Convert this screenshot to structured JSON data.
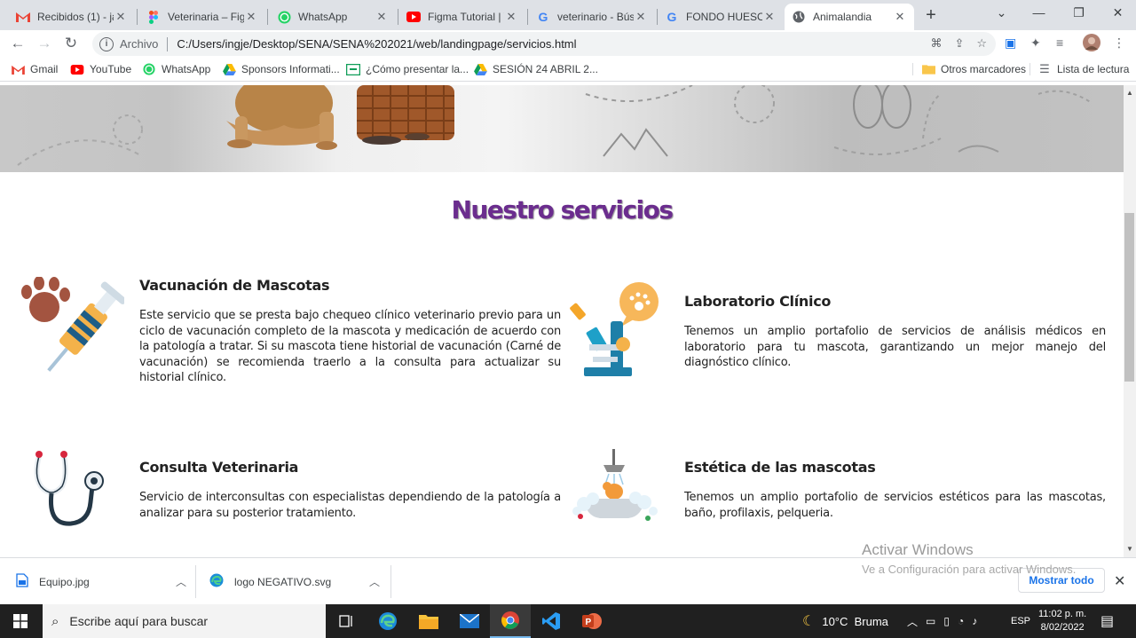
{
  "browser": {
    "tabs": [
      {
        "label": "Recibidos (1) - ja",
        "icon": "gmail-icon",
        "active": false
      },
      {
        "label": "Veterinaria – Figm",
        "icon": "figma-icon",
        "active": false
      },
      {
        "label": "WhatsApp",
        "icon": "whatsapp-icon",
        "active": false
      },
      {
        "label": "Figma Tutorial | V",
        "icon": "youtube-icon",
        "active": false
      },
      {
        "label": "veterinario - Búsq",
        "icon": "google-icon",
        "active": false
      },
      {
        "label": "FONDO HUESOS",
        "icon": "google-icon",
        "active": false
      },
      {
        "label": "Animalandia",
        "icon": "globe-icon",
        "active": true
      }
    ],
    "address": {
      "scheme": "Archivo",
      "url": "C:/Users/ingje/Desktop/SENA/SENA%202021/web/landingpage/servicios.html"
    },
    "bookmarks": [
      {
        "label": "Gmail",
        "icon": "gmail-icon"
      },
      {
        "label": "YouTube",
        "icon": "youtube-icon"
      },
      {
        "label": "WhatsApp",
        "icon": "whatsapp-icon"
      },
      {
        "label": "Sponsors Informati...",
        "icon": "drive-icon"
      },
      {
        "label": "¿Cómo presentar la...",
        "icon": "classroom-icon"
      },
      {
        "label": "SESIÓN 24 ABRIL 2...",
        "icon": "drive-icon"
      }
    ],
    "other_bookmarks": "Otros marcadores",
    "reading_list": "Lista de lectura"
  },
  "page": {
    "section_title": "Nuestro servicios",
    "services": [
      {
        "title": "Vacunación de Mascotas",
        "description": "Este servicio que se presta bajo chequeo clínico veterinario previo para un ciclo de vacunación completo de la mascota y medicación de acuerdo con la patología a tratar. Si su mascota tiene historial de vacunación (Carné de vacunación) se recomienda traerlo a la consulta para actualizar su historial clínico.",
        "icon": "vaccine-syringe-icon"
      },
      {
        "title": "Laboratorio Clínico",
        "description": "Tenemos un amplio portafolio de servicios de análisis médicos en laboratorio para tu mascota, garantizando un mejor manejo del diagnóstico clínico.",
        "icon": "microscope-icon"
      },
      {
        "title": "Consulta Veterinaria",
        "description": "Servicio de interconsultas con especialistas dependiendo de la patología a analizar para su posterior tratamiento.",
        "icon": "stethoscope-icon"
      },
      {
        "title": "Estética de las mascotas",
        "description": "Tenemos un amplio portafolio de servicios estéticos para las mascotas, baño, profilaxis, pelqueria.",
        "icon": "dog-bath-icon"
      }
    ]
  },
  "windows_activation": {
    "title": "Activar Windows",
    "subtitle": "Ve a Configuración para activar Windows."
  },
  "downloads": {
    "items": [
      {
        "name": "Equipo.jpg",
        "icon": "image-file-icon"
      },
      {
        "name": "logo NEGATIVO.svg",
        "icon": "edge-file-icon"
      }
    ],
    "show_all": "Mostrar todo"
  },
  "taskbar": {
    "search_placeholder": "Escribe aquí para buscar",
    "weather": "10°C  Bruma",
    "language": "ESP",
    "time": "11:02 p. m.",
    "date": "8/02/2022"
  },
  "colors": {
    "title_purple": "#6b2d8e",
    "link_blue": "#1a73e8",
    "taskbar": "#202020"
  }
}
